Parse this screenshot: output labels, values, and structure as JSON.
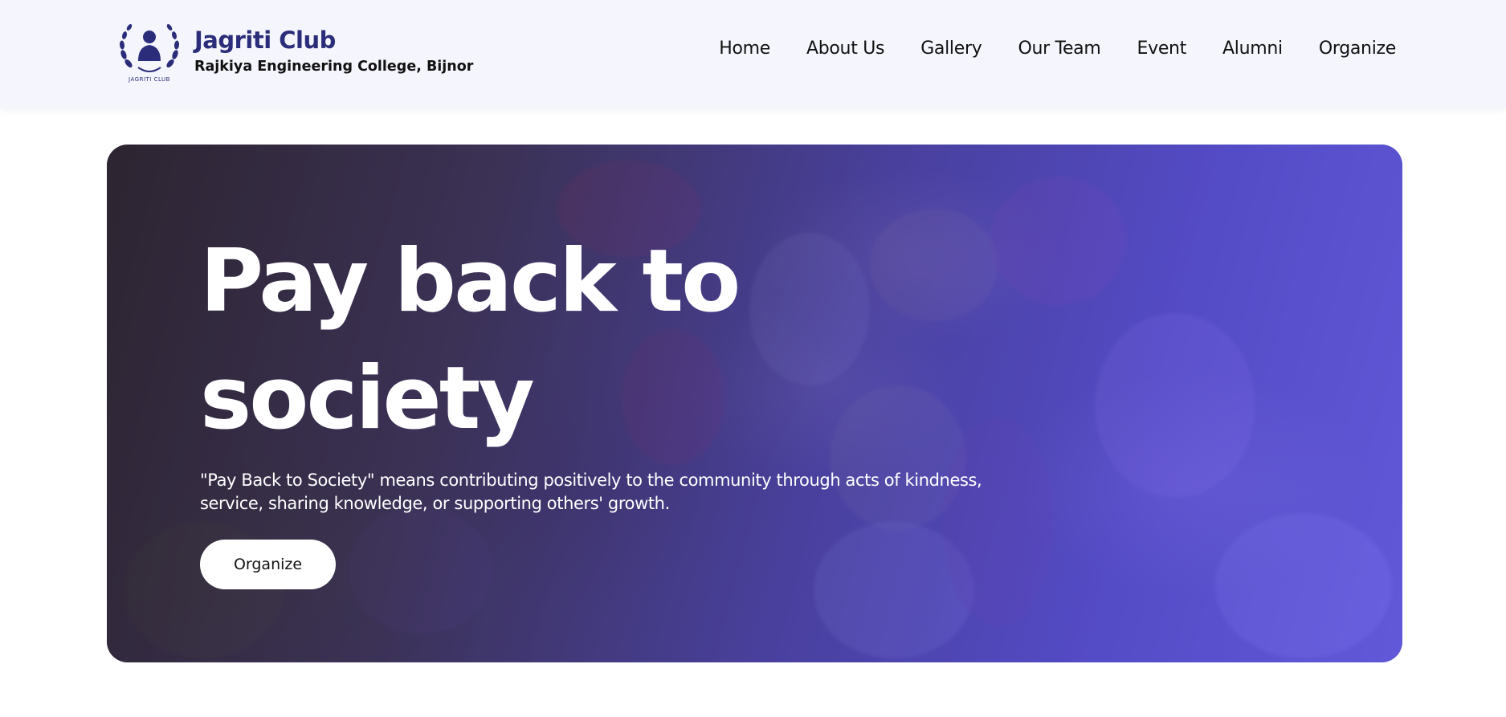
{
  "header": {
    "brand_title": "Jagriti Club",
    "brand_subtitle": "Rajkiya Engineering College, Bijnor",
    "logo_caption": "JAGRITI CLUB",
    "nav": [
      {
        "label": "Home"
      },
      {
        "label": "About Us"
      },
      {
        "label": "Gallery"
      },
      {
        "label": "Our Team"
      },
      {
        "label": "Event"
      },
      {
        "label": "Alumni"
      },
      {
        "label": "Organize"
      }
    ]
  },
  "hero": {
    "title": "Pay back to society",
    "description": "\"Pay Back to Society\" means contributing positively to the community through acts of kindness, service, sharing knowledge, or supporting others' growth.",
    "button_label": "Organize"
  },
  "colors": {
    "header_bg": "#f5f6fd",
    "brand": "#2b2d7a",
    "overlay_accent": "#5a50e0"
  }
}
